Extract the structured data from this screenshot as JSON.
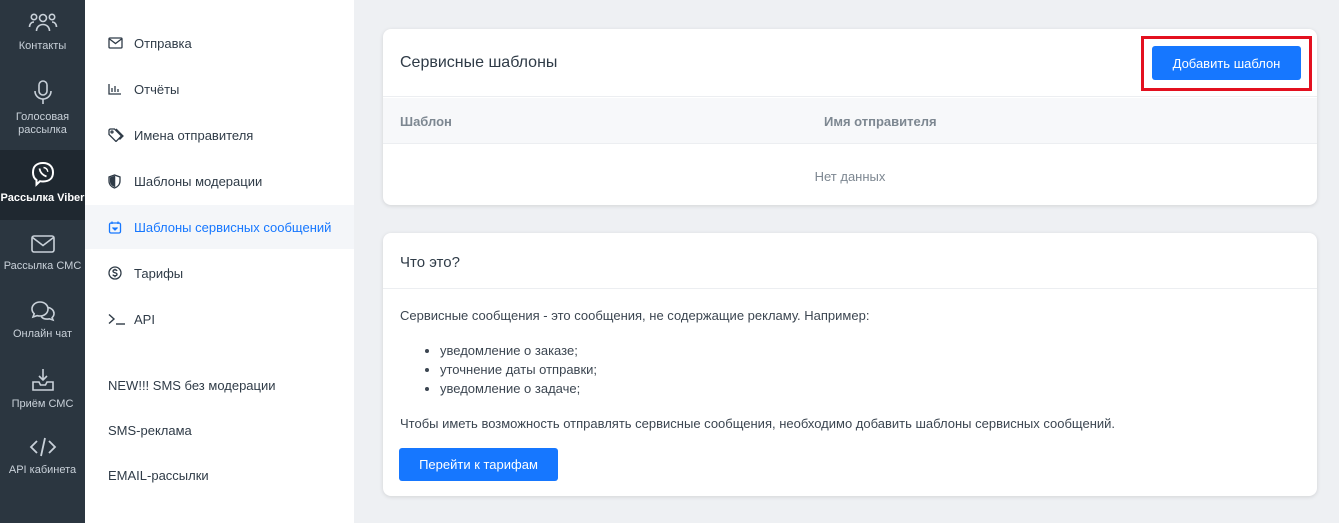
{
  "rail": {
    "items": [
      {
        "label": "Контакты",
        "icon": "contacts-icon"
      },
      {
        "label": "Голосовая рассылка",
        "icon": "microphone-icon"
      },
      {
        "label": "Рассылка Viber",
        "icon": "viber-icon"
      },
      {
        "label": "Рассылка СМС",
        "icon": "envelope-icon"
      },
      {
        "label": "Онлайн чат",
        "icon": "chat-icon"
      },
      {
        "label": "Приём СМС",
        "icon": "inbox-download-icon"
      },
      {
        "label": "API кабинета",
        "icon": "code-icon"
      }
    ],
    "active_index": 2
  },
  "submenu": {
    "items": [
      {
        "label": "Отправка",
        "icon": "envelope-icon"
      },
      {
        "label": "Отчёты",
        "icon": "bar-chart-icon"
      },
      {
        "label": "Имена отправителя",
        "icon": "tag-icon"
      },
      {
        "label": "Шаблоны модерации",
        "icon": "shield-icon"
      },
      {
        "label": "Шаблоны сервисных сообщений",
        "icon": "service-template-icon"
      },
      {
        "label": "Тарифы",
        "icon": "dollar-circle-icon"
      },
      {
        "label": "API",
        "icon": "terminal-icon"
      }
    ],
    "links": [
      {
        "label": "NEW!!! SMS без модерации"
      },
      {
        "label": "SMS-реклама"
      },
      {
        "label": "EMAIL-рассылки"
      }
    ],
    "active_index": 4
  },
  "templates_card": {
    "title": "Сервисные шаблоны",
    "add_button": "Добавить шаблон",
    "columns": [
      "Шаблон",
      "Имя отправителя"
    ],
    "empty_text": "Нет данных"
  },
  "info_card": {
    "title": "Что это?",
    "intro": "Сервисные сообщения - это сообщения, не содержащие рекламу. Например:",
    "examples": [
      "уведомление о заказе;",
      "уточнение даты отправки;",
      "уведомление о задаче;"
    ],
    "note": "Чтобы иметь возможность отправлять сервисные сообщения, необходимо добавить шаблоны сервисных сообщений.",
    "tariffs_button": "Перейти к тарифам"
  },
  "colors": {
    "accent": "#1677ff",
    "rail_bg": "#2b3640",
    "highlight": "#e3101f"
  }
}
